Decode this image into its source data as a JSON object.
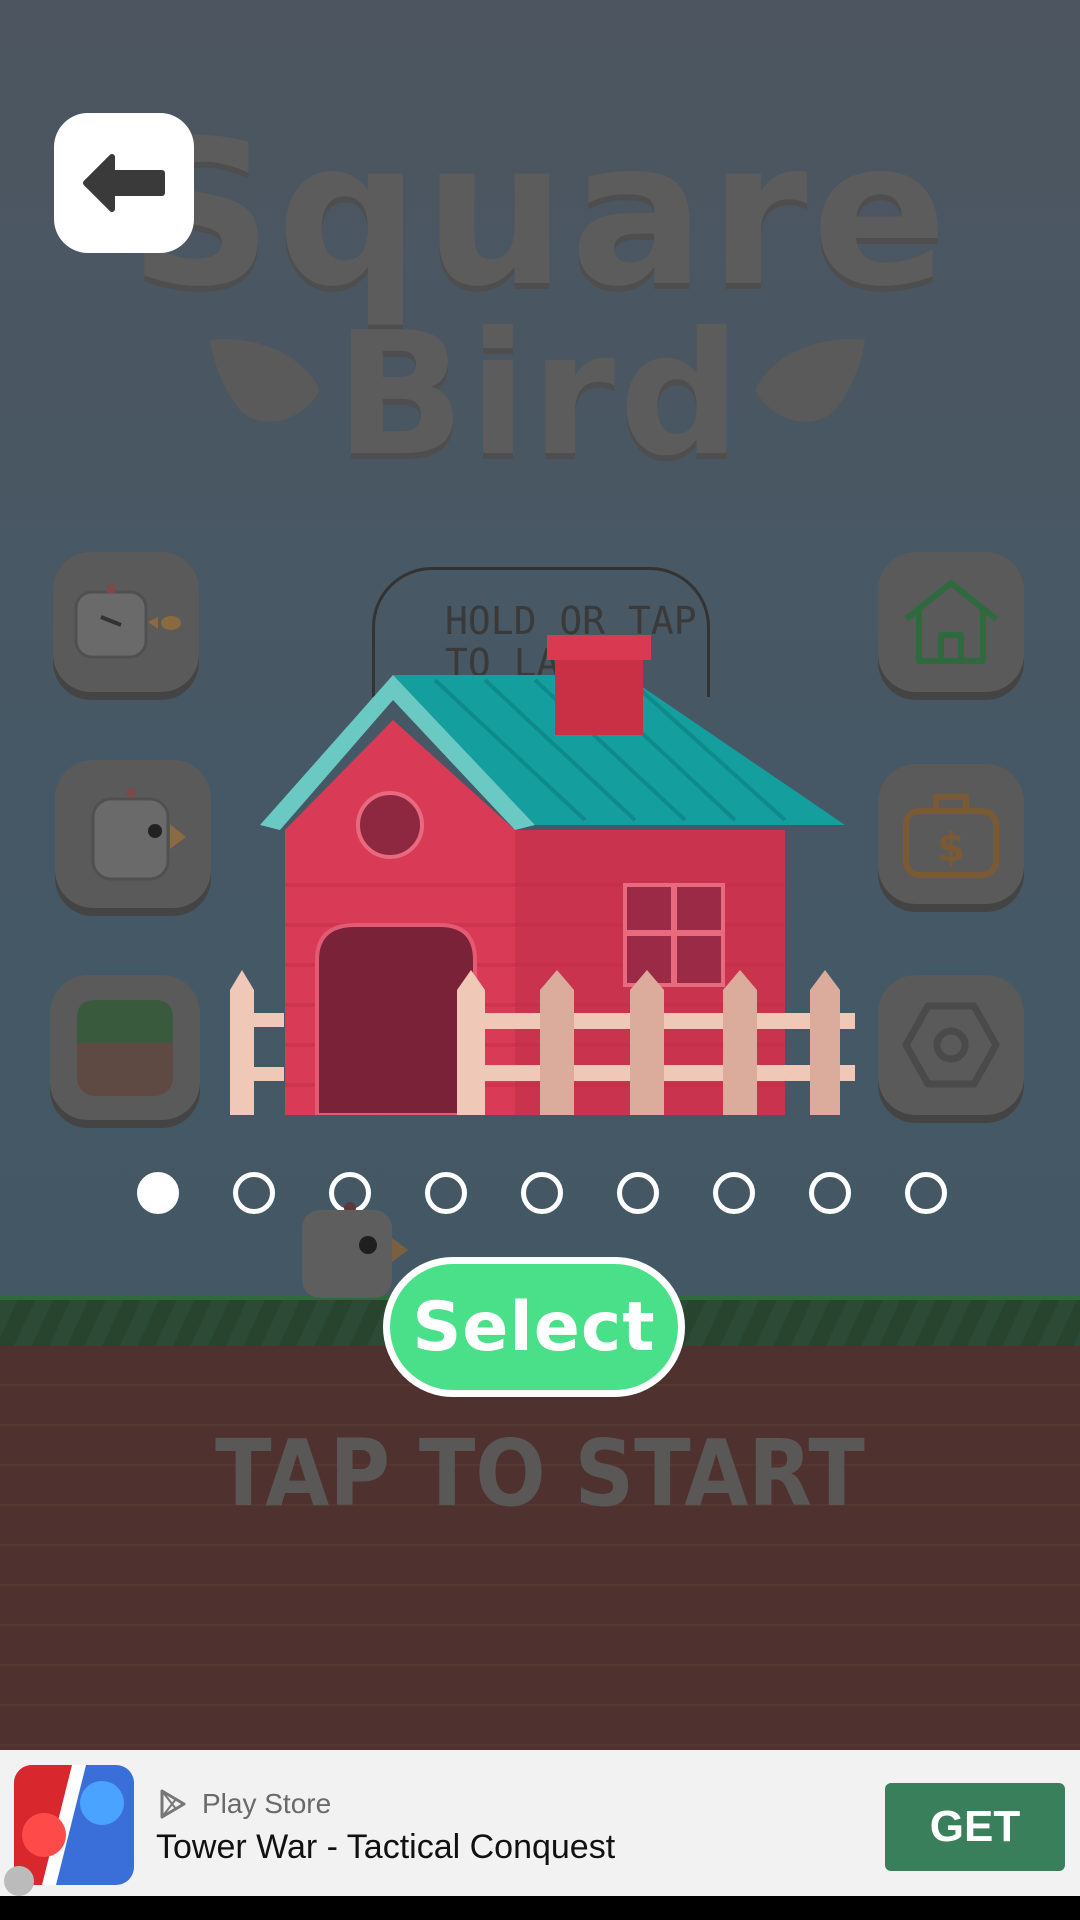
{
  "game": {
    "title_line1": "Square",
    "title_line2": "Bird",
    "hint": [
      "HOLD OR TAP",
      "TO LAY"
    ],
    "select_label": "Select",
    "tap_to_start": "TAP TO START",
    "pager": {
      "count": 9,
      "active_index": 0
    }
  },
  "side_buttons": {
    "left": [
      "angry-bird-icon",
      "bird-icon",
      "grass-block-icon"
    ],
    "right": [
      "home-icon",
      "money-bag-icon",
      "settings-icon"
    ]
  },
  "ad": {
    "store_label": "Play Store",
    "app_title": "Tower War - Tactical Conquest",
    "cta": "GET"
  },
  "colors": {
    "accent_green": "#4ae08a",
    "house_red": "#d43a55",
    "roof_teal": "#17a5a5",
    "get_button": "#3a7f5c"
  }
}
